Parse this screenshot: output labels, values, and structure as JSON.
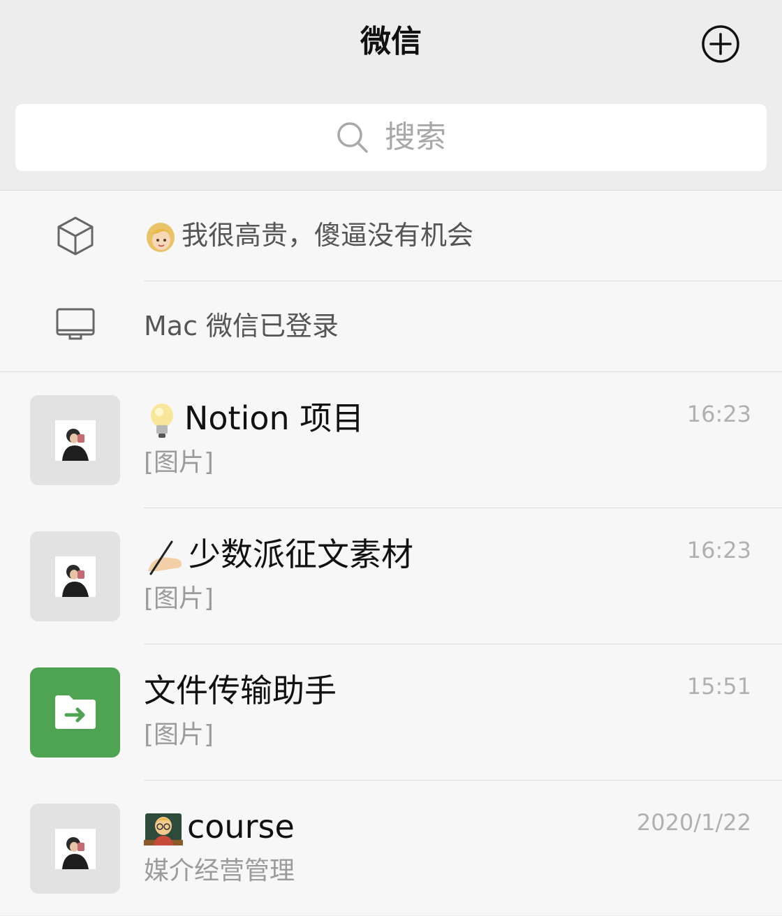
{
  "header": {
    "title": "微信",
    "add_icon": "plus-circle-icon"
  },
  "search": {
    "placeholder": "搜索",
    "icon": "search-icon"
  },
  "system_rows": [
    {
      "icon": "box-icon",
      "emoji": "woman-blonde-emoji",
      "text": "我很高贵，傻逼没有机会"
    },
    {
      "icon": "monitor-icon",
      "text": "Mac 微信已登录"
    }
  ],
  "chats": [
    {
      "emoji": "light-bulb-emoji",
      "name": "Notion 项目",
      "preview": "[图片]",
      "time": "16:23",
      "avatar": "photo"
    },
    {
      "emoji": "writing-hand-emoji",
      "name": "少数派征文素材",
      "preview": "[图片]",
      "time": "16:23",
      "avatar": "photo"
    },
    {
      "name": "文件传输助手",
      "preview": "[图片]",
      "time": "15:51",
      "avatar": "file-transfer-icon"
    },
    {
      "emoji": "teacher-emoji",
      "name": "course",
      "preview": "媒介经营管理",
      "time": "2020/1/22",
      "avatar": "photo"
    }
  ],
  "colors": {
    "header_bg": "#ededed",
    "list_bg": "#f7f7f7",
    "file_transfer_green": "#4fa453",
    "time_gray": "#b0b0b0",
    "preview_gray": "#9b9b9b"
  }
}
